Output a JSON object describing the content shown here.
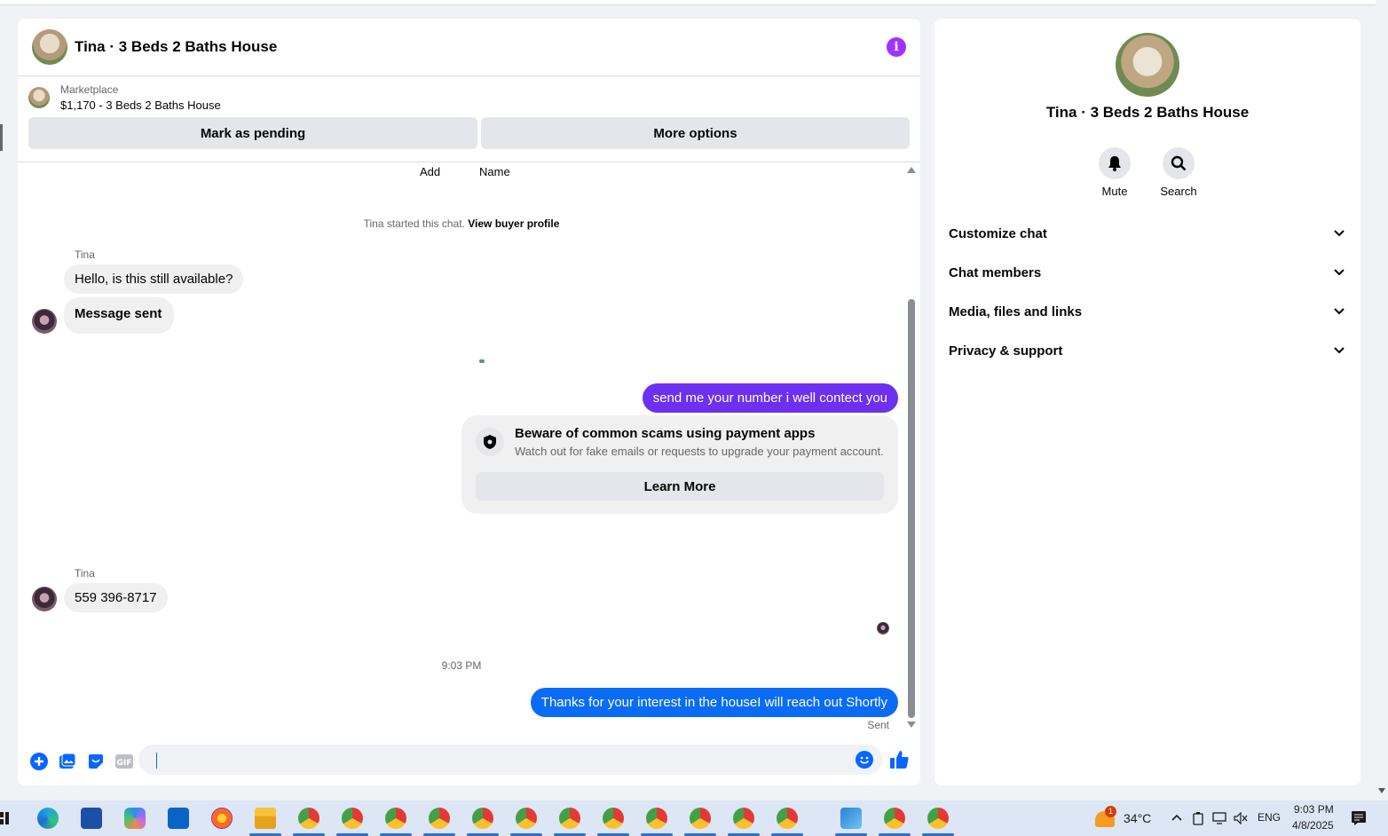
{
  "chat": {
    "title": "Tina · 3 Beds 2 Baths House",
    "marketplace_label": "Marketplace",
    "listing": "$1,170 - 3 Beds 2 Baths House",
    "mark_pending": "Mark as pending",
    "more_options": "More options",
    "columns": [
      "Add",
      "Name"
    ],
    "start_note_prefix": "Tina started this chat.",
    "start_note_link": "View buyer profile",
    "messages": [
      {
        "sender": "Tina",
        "text": "Hello, is this still available?"
      },
      {
        "text": "Message sent"
      },
      {
        "text": "send me your number i well contect you"
      },
      {
        "sender": "Tina",
        "text": "559 396-8717"
      },
      {
        "text": "Thanks for your interest in the houseI will reach out Shortly"
      }
    ],
    "scam_title": "Beware of common scams using payment apps",
    "scam_sub": "Watch out for fake emails or requests to upgrade your payment account.",
    "learn_more": "Learn More",
    "time": "9:03 PM",
    "sent": "Sent",
    "colors": {
      "outgoing_purple": "#6d2ff0",
      "outgoing_blue": "#0a6cf5",
      "accent": "#0866ff",
      "info": "#a033ff"
    }
  },
  "side": {
    "title": "Tina · 3 Beds 2 Baths House",
    "mute": "Mute",
    "search": "Search",
    "rows": [
      "Customize chat",
      "Chat members",
      "Media, files and links",
      "Privacy & support"
    ]
  },
  "taskbar": {
    "weather": "34°C",
    "weather_badge": "1",
    "lang": "ENG",
    "time": "9:03 PM",
    "date": "4/8/2025"
  }
}
